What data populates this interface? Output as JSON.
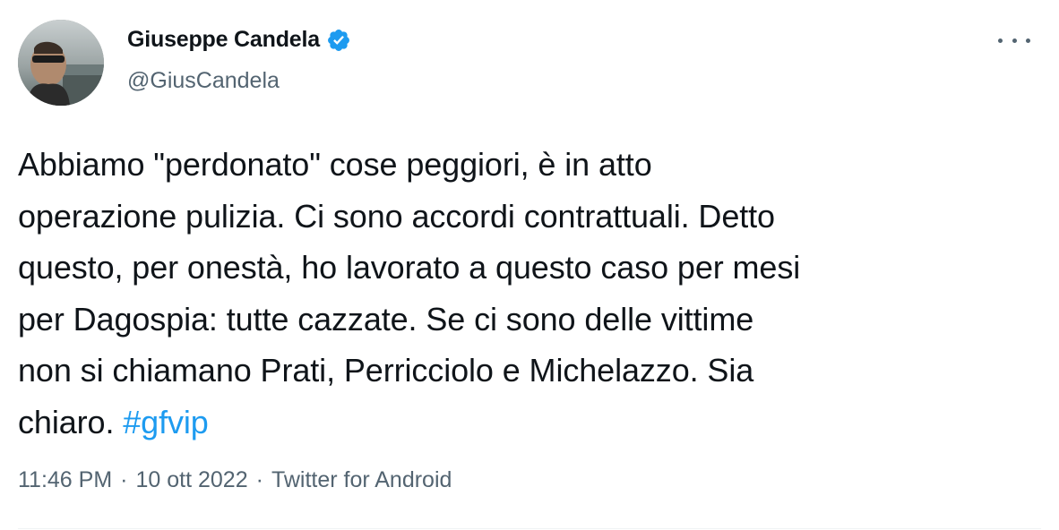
{
  "author": {
    "display_name": "Giuseppe Candela",
    "handle": "@GiusCandela",
    "verified": true
  },
  "more_icon": "ellipsis-icon",
  "tweet": {
    "lines": [
      "Abbiamo \"perdonato\" cose peggiori, è in atto",
      "operazione pulizia. Ci sono accordi contrattuali. Detto",
      "questo, per onestà, ho lavorato a questo caso per mesi",
      "per Dagospia: tutte cazzate. Se ci sono delle vittime",
      "non si chiamano Prati, Perricciolo e Michelazzo. Sia"
    ],
    "last_line_text": "chiaro. ",
    "hashtag": "#gfvip"
  },
  "meta": {
    "time": "11:46 PM",
    "separator": "·",
    "date": "10 ott 2022",
    "source": "Twitter for Android"
  },
  "colors": {
    "text": "#0f1419",
    "secondary": "#536471",
    "link": "#1d9bf0",
    "verified": "#1d9bf0"
  }
}
